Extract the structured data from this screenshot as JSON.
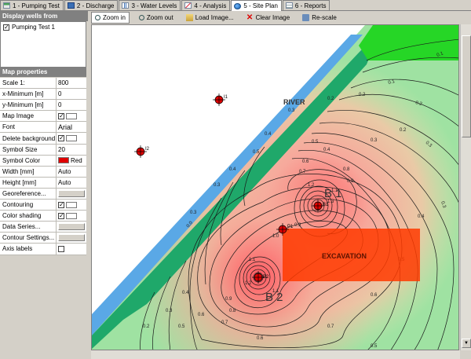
{
  "tabs": [
    {
      "label": "1 - Pumping Test",
      "icon": "pumping-test-icon"
    },
    {
      "label": "2 - Discharge",
      "icon": "discharge-icon"
    },
    {
      "label": "3 - Water Levels",
      "icon": "water-levels-icon"
    },
    {
      "label": "4 - Analysis",
      "icon": "analysis-icon"
    },
    {
      "label": "5 - Site Plan",
      "icon": "site-plan-globe-icon",
      "active": true
    },
    {
      "label": "6 - Reports",
      "icon": "reports-icon"
    }
  ],
  "wells_panel": {
    "title": "Display wells from",
    "items": [
      {
        "label": "Pumping Test 1",
        "checked": true
      }
    ]
  },
  "map_properties": {
    "title": "Map properties",
    "rows": [
      {
        "label": "Scale 1:",
        "value": "800"
      },
      {
        "label": "x-Minimum [m]",
        "value": "0"
      },
      {
        "label": "y-Minimum [m]",
        "value": "0"
      },
      {
        "label": "Map Image",
        "checkbox": true,
        "checked": true,
        "swatch": true
      },
      {
        "label": "Font",
        "value": "Arial"
      },
      {
        "label": "Delete background",
        "checkbox": true,
        "checked": true,
        "swatch": true
      },
      {
        "label": "Symbol Size",
        "value": "20"
      },
      {
        "label": "Symbol Color",
        "value": "Red",
        "color": "#e00000"
      },
      {
        "label": "Width [mm]",
        "value": "Auto"
      },
      {
        "label": "Height [mm]",
        "value": "Auto"
      },
      {
        "label": "Georeference...",
        "button": true
      },
      {
        "label": "Contouring",
        "checkbox": true,
        "checked": true,
        "swatch": true
      },
      {
        "label": "Color shading",
        "checkbox": true,
        "checked": true,
        "swatch": true
      },
      {
        "label": "Data Series...",
        "button": true
      },
      {
        "label": "Contour Settings...",
        "button": true
      },
      {
        "label": "Axis labels",
        "checkbox": true,
        "checked": false
      }
    ]
  },
  "toolbar": {
    "zoom_in": "Zoom in",
    "zoom_out": "Zoom out",
    "load_image": "Load Image...",
    "clear_image": "Clear Image",
    "rescale": "Re-scale"
  },
  "map": {
    "river_label": "RIVER",
    "excavation_label": "EXCAVATION",
    "b1_label": "B 1",
    "b2_label": "B 2",
    "wells": [
      {
        "id": "I1",
        "label": "I1"
      },
      {
        "id": "I2",
        "label": "I2"
      },
      {
        "id": "B1",
        "label": "B1"
      },
      {
        "id": "B2",
        "label": "B2"
      },
      {
        "id": "P1",
        "label": "P1"
      }
    ],
    "contour_values_shown": [
      "0.1",
      "0.2",
      "0.3",
      "0.4",
      "0.5",
      "0.6",
      "0.7",
      "0.8",
      "0.9",
      "1.0",
      "1.1",
      "1.2",
      "1.3"
    ],
    "colors": {
      "well_symbol": "#e00000",
      "excavation": "#ff3300",
      "river_blue": "#5aa8e6",
      "river_green": "#1fa86a",
      "top_green": "#26d626"
    }
  }
}
